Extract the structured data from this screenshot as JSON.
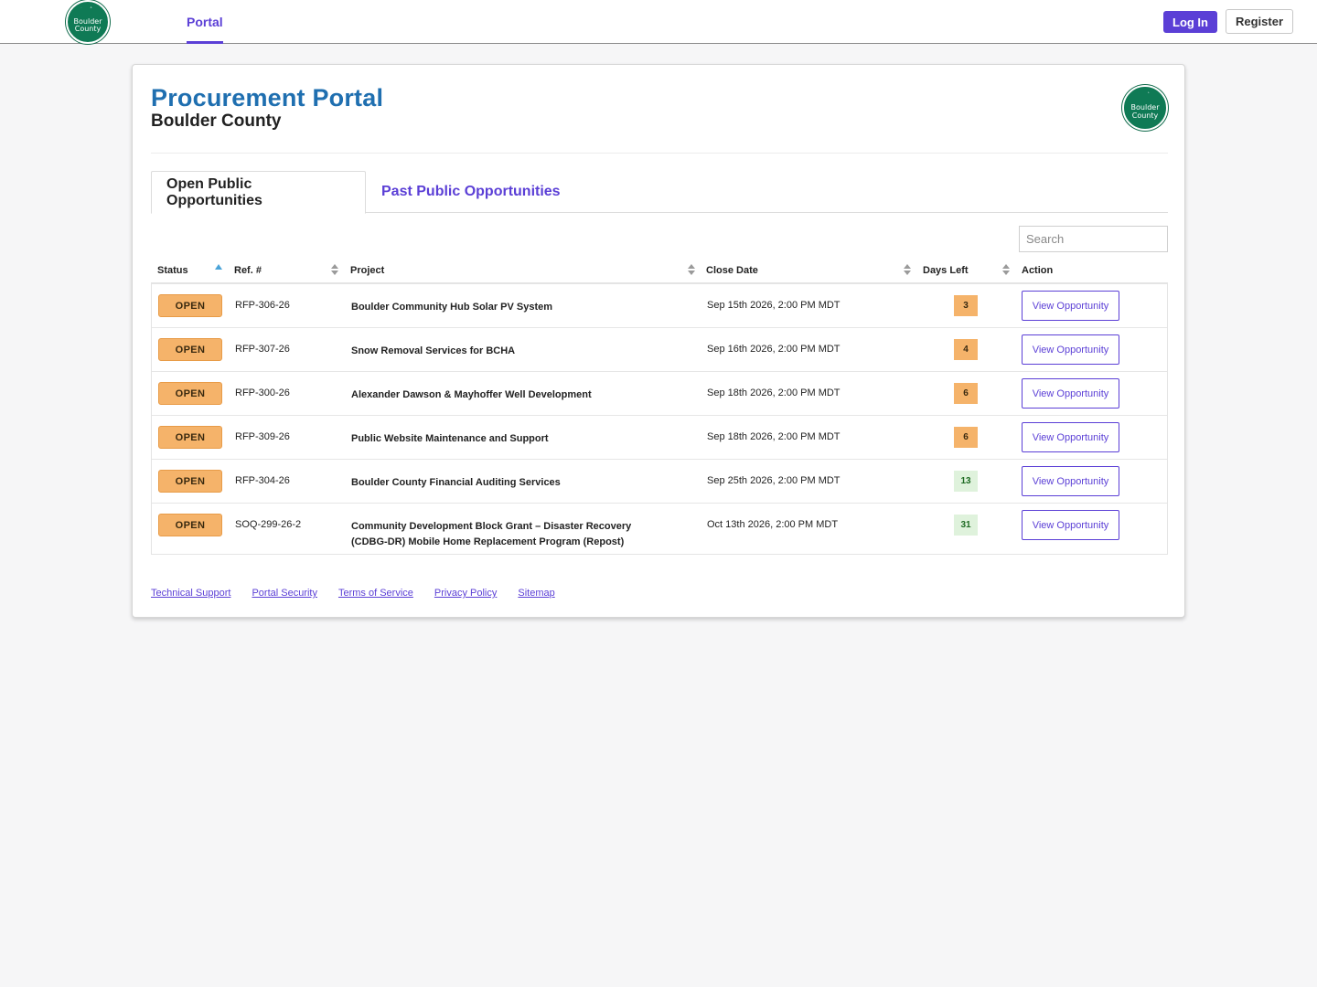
{
  "header": {
    "nav_portal": "Portal",
    "login": "Log In",
    "register": "Register",
    "seal_text_line1": "Boulder",
    "seal_text_line2": "County"
  },
  "page": {
    "title": "Procurement Portal",
    "subtitle": "Boulder County"
  },
  "tabs": {
    "open": "Open Public Opportunities",
    "past": "Past Public Opportunities"
  },
  "search": {
    "placeholder": "Search"
  },
  "table": {
    "headers": {
      "status": "Status",
      "ref": "Ref. #",
      "project": "Project",
      "close_date": "Close Date",
      "days_left": "Days Left",
      "action": "Action"
    },
    "rows": [
      {
        "status": "OPEN",
        "ref": "RFP-306-26",
        "project": "Boulder Community Hub Solar PV System",
        "close_date": "Sep 15th 2026, 2:00 PM MDT",
        "days_left": "3",
        "action": "View Opportunity"
      },
      {
        "status": "OPEN",
        "ref": "RFP-307-26",
        "project": "Snow Removal Services for BCHA",
        "close_date": "Sep 16th 2026, 2:00 PM MDT",
        "days_left": "4",
        "action": "View Opportunity"
      },
      {
        "status": "OPEN",
        "ref": "RFP-300-26",
        "project": "Alexander Dawson & Mayhoffer Well Development",
        "close_date": "Sep 18th 2026, 2:00 PM MDT",
        "days_left": "6",
        "action": "View Opportunity"
      },
      {
        "status": "OPEN",
        "ref": "RFP-309-26",
        "project": "Public Website Maintenance and Support",
        "close_date": "Sep 18th 2026, 2:00 PM MDT",
        "days_left": "6",
        "action": "View Opportunity"
      },
      {
        "status": "OPEN",
        "ref": "RFP-304-26",
        "project": "Boulder County Financial Auditing Services",
        "close_date": "Sep 25th 2026, 2:00 PM MDT",
        "days_left": "13",
        "action": "View Opportunity"
      },
      {
        "status": "OPEN",
        "ref": "SOQ-299-26-2",
        "project": "Community Development Block Grant – Disaster Recovery (CDBG-DR) Mobile Home Replacement Program (Repost)",
        "close_date": "Oct 13th 2026, 2:00 PM MDT",
        "days_left": "31",
        "action": "View Opportunity"
      }
    ]
  },
  "footer": {
    "links": [
      "Technical Support",
      "Portal Security",
      "Terms of Service",
      "Privacy Policy",
      "Sitemap"
    ]
  },
  "colors": {
    "accent": "#5b3fd6",
    "title_blue": "#1f6fb0",
    "open_badge": "#f5b36a",
    "days_ok": "#dff2dc",
    "seal_green": "#0f7a55"
  }
}
